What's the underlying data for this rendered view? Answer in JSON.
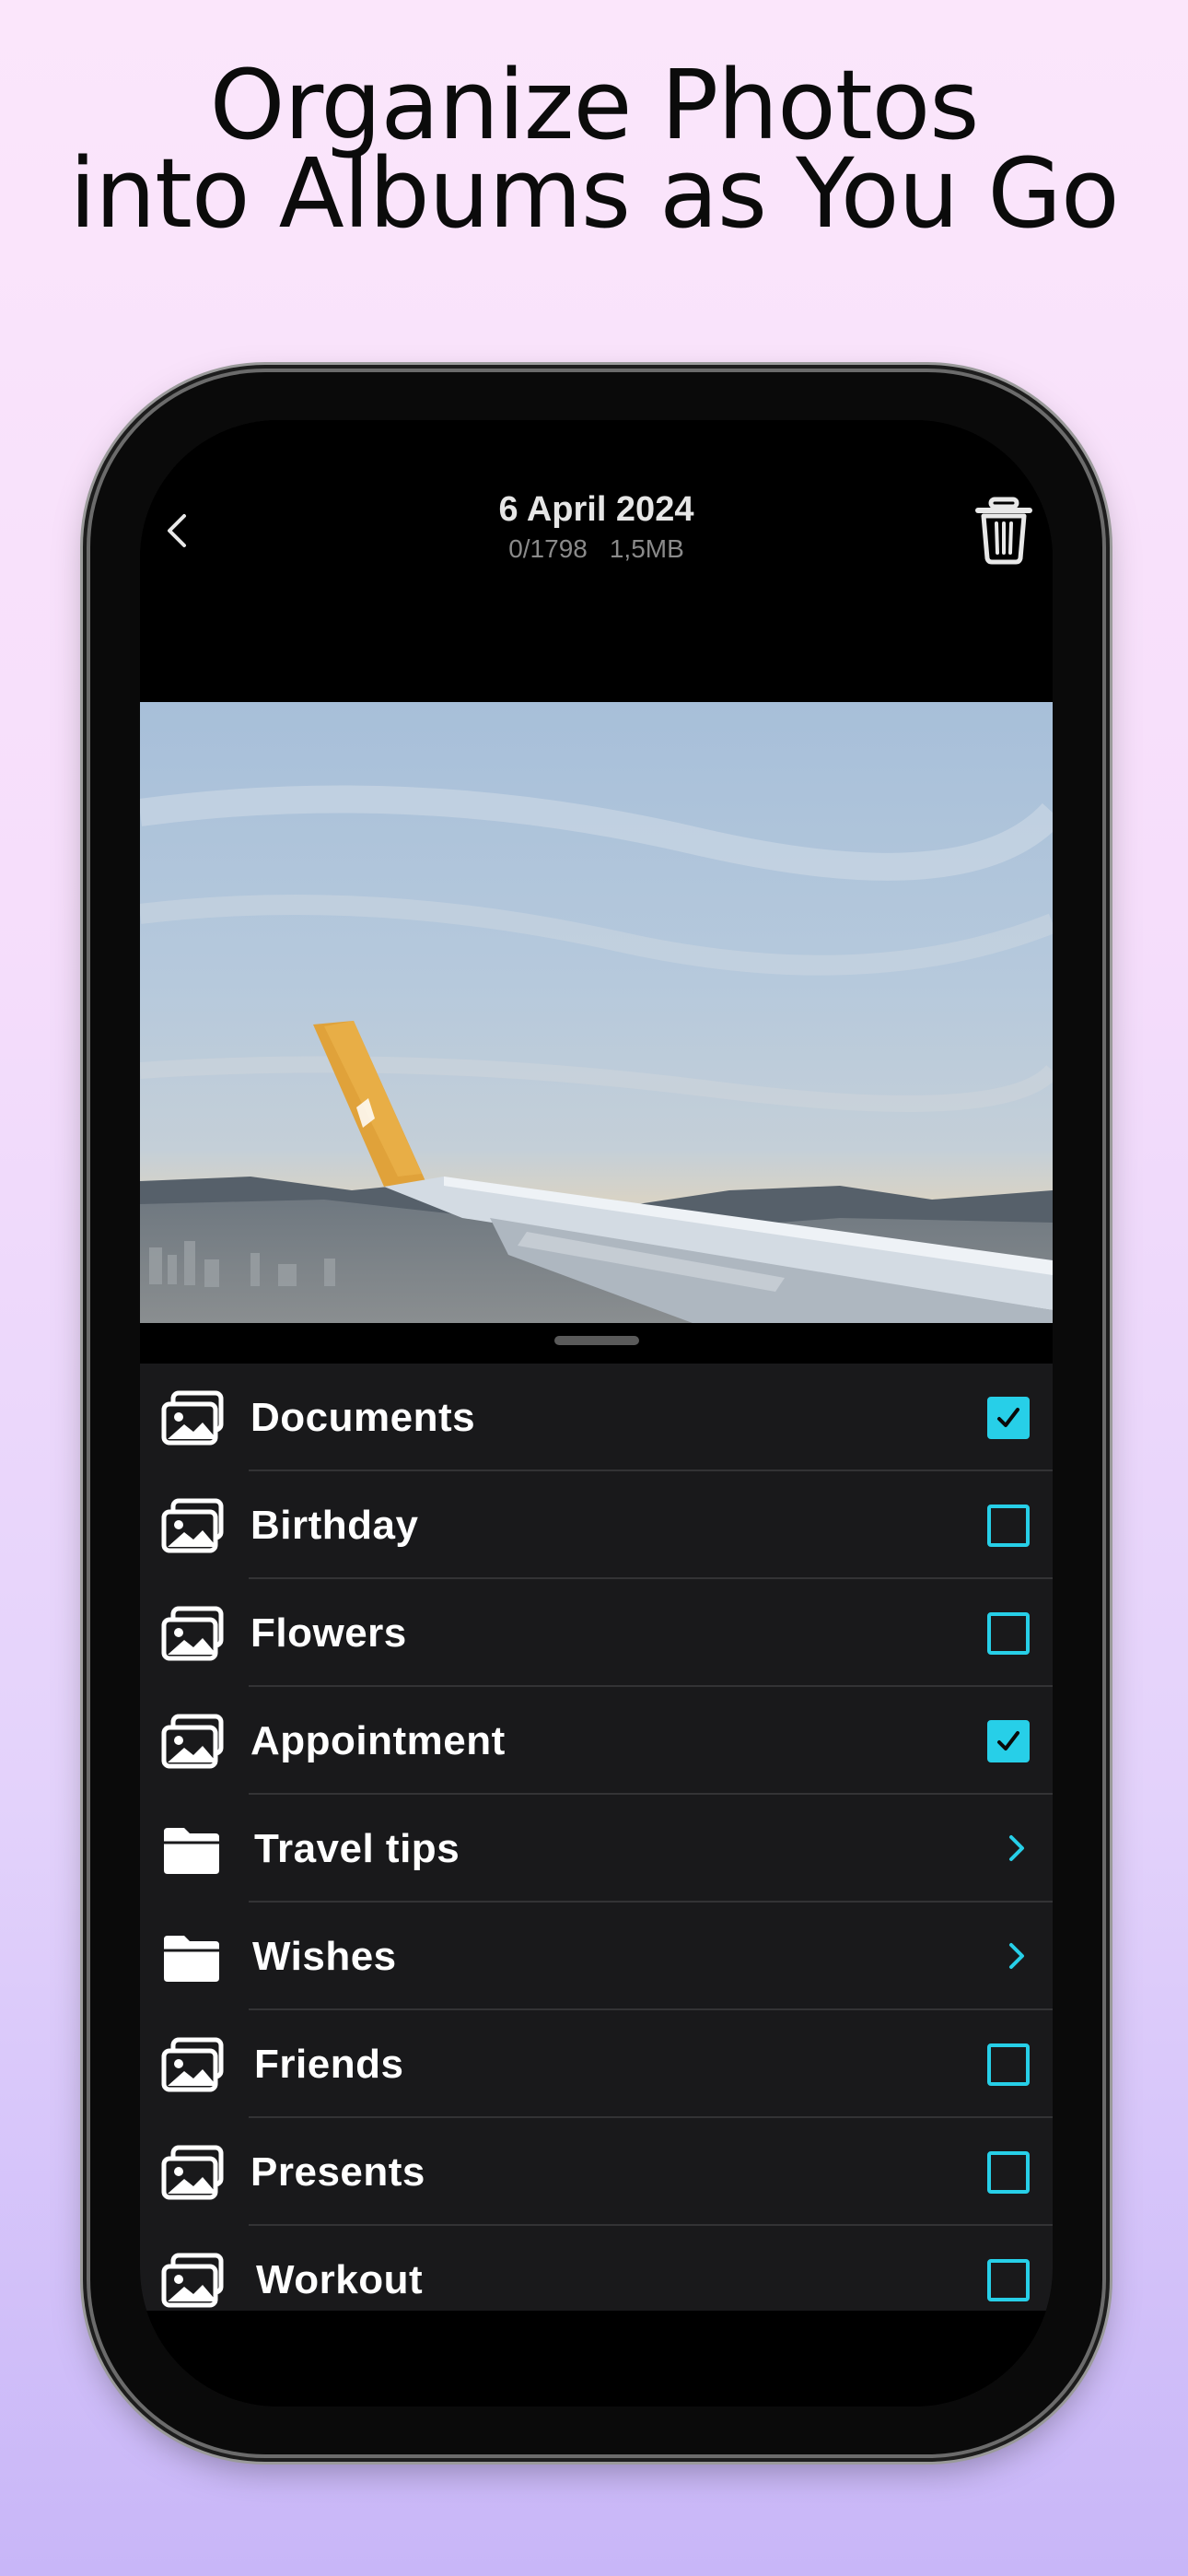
{
  "headline": {
    "line1": "Organize Photos",
    "line2": "into Albums as You Go"
  },
  "navbar": {
    "date": "6 April 2024",
    "counter": "0/1798",
    "size": "1,5MB",
    "back_icon": "chevron-left-icon",
    "delete_icon": "trash-icon"
  },
  "photo": {
    "description": "airplane-wing-over-city-sky"
  },
  "colors": {
    "accent": "#27cfe8",
    "list_bg": "#19191b"
  },
  "albums": [
    {
      "label": "Documents",
      "type": "album",
      "checked": true
    },
    {
      "label": "Birthday",
      "type": "album",
      "checked": false
    },
    {
      "label": "Flowers",
      "type": "album",
      "checked": false
    },
    {
      "label": "Appointment",
      "type": "album",
      "checked": true
    },
    {
      "label": "Travel tips",
      "type": "folder"
    },
    {
      "label": "Wishes",
      "type": "folder"
    },
    {
      "label": "Friends",
      "type": "album",
      "checked": false
    },
    {
      "label": "Presents",
      "type": "album",
      "checked": false
    },
    {
      "label": "Workout",
      "type": "album",
      "checked": false
    }
  ]
}
